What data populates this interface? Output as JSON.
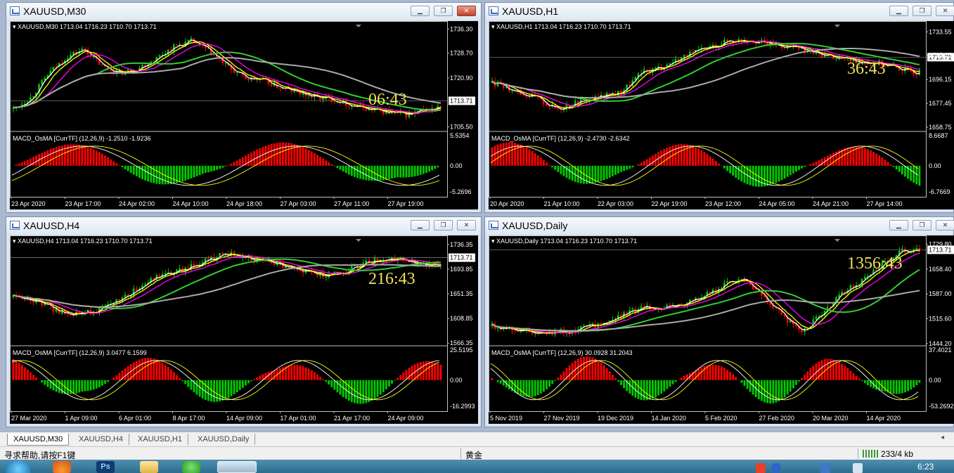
{
  "windows": [
    {
      "title": "XAUUSD,M30",
      "header": "XAUUSD,M30  1713.04 1716.23 1710.70 1713.71",
      "timer": "06:43",
      "price_ticks": [
        "1736.30",
        "1728.70",
        "1720.90",
        "1705.50"
      ],
      "price_ticks_y": [
        1736.3,
        1728.7,
        1720.9,
        1705.5
      ],
      "price_range": [
        1704.3,
        1738.8
      ],
      "current_price": "1713.71",
      "macd_label": "MACD_OsMA [CurrTF] (12,26,9) -1.2510 -1.9236",
      "macd_ticks": [
        "5.5354",
        "0.00",
        "-5.2696"
      ],
      "time_labels": [
        "23 Apr 2020",
        "23 Apr 17:00",
        "24 Apr 02:00",
        "24 Apr 10:00",
        "24 Apr 18:00",
        "27 Apr 03:00",
        "27 Apr 11:00",
        "27 Apr 19:00"
      ]
    },
    {
      "title": "XAUUSD,H1",
      "header": "XAUUSD,H1  1713.04 1716.23 1710.70 1713.71",
      "timer": "36:43",
      "price_ticks": [
        "1733.55",
        "1715.15",
        "1696.15",
        "1677.45",
        "1658.75"
      ],
      "price_ticks_y": [
        1733.55,
        1715.15,
        1696.15,
        1677.45,
        1658.75
      ],
      "price_range": [
        1656.0,
        1742.0
      ],
      "current_price": "1713.71",
      "macd_label": "MACD_OsMA [CurrTF] (12,26,9) -2.4730 -2.6342",
      "macd_ticks": [
        "8.6687",
        "0.00",
        "-6.7669"
      ],
      "time_labels": [
        "20 Apr 2020",
        "21 Apr 10:00",
        "22 Apr 03:00",
        "22 Apr 19:00",
        "23 Apr 12:00",
        "24 Apr 05:00",
        "24 Apr 21:00",
        "27 Apr 14:00"
      ]
    },
    {
      "title": "XAUUSD,H4",
      "header": "XAUUSD,H4  1713.04 1716.23 1710.70 1713.71",
      "timer": "216:43",
      "price_ticks": [
        "1736.35",
        "1693.85",
        "1651.35",
        "1608.85",
        "1566.35"
      ],
      "price_ticks_y": [
        1736.35,
        1693.85,
        1651.35,
        1608.85,
        1566.35
      ],
      "price_range": [
        1563.0,
        1752.0
      ],
      "current_price": "1713.71",
      "macd_label": "MACD_OsMA [CurrTF] (12,26,9) 3.0477 6.1599",
      "macd_ticks": [
        "25.5195",
        "0.00",
        "-16.2993"
      ],
      "time_labels": [
        "27 Mar 2020",
        "1 Apr 09:00",
        "6 Apr 01:00",
        "8 Apr 17:00",
        "14 Apr 09:00",
        "17 Apr 01:00",
        "21 Apr 17:00",
        "24 Apr 09:00"
      ]
    },
    {
      "title": "XAUUSD,Daily",
      "header": "XAUUSD,Daily  1713.04 1716.23 1710.70 1713.71",
      "timer": "1356:43",
      "price_ticks": [
        "1729.80",
        "1658.40",
        "1587.00",
        "1515.60",
        "1444.20"
      ],
      "price_ticks_y": [
        1729.8,
        1658.4,
        1587.0,
        1515.6,
        1444.2
      ],
      "price_range": [
        1440.0,
        1755.0
      ],
      "current_price": "1713.71",
      "macd_label": "MACD_OsMA [CurrTF] (12,26,9) 30.0928 31.2043",
      "macd_ticks": [
        "37.4021",
        "0.00",
        "-53.2692"
      ],
      "time_labels": [
        "5 Nov 2019",
        "27 Nov 2019",
        "19 Dec 2019",
        "14 Jan 2020",
        "5 Feb 2020",
        "27 Feb 2020",
        "20 Mar 2020",
        "14 Apr 2020"
      ]
    }
  ],
  "tabs": [
    "XAUUSD,M30",
    "XAUUSD,H4",
    "XAUUSD,H1",
    "XAUUSD,Daily"
  ],
  "status": {
    "help": "寻求帮助,请按F1键",
    "profile": "黄金",
    "traffic": "233/4 kb"
  },
  "clock": "6:23",
  "window_buttons": {
    "minimize": "▁",
    "restore": "❐",
    "close": "✕"
  },
  "colors": {
    "background": "#000000",
    "bull_candle": "#00c800",
    "bear_candle": "#ff0000",
    "ma_fast": "#ffffff",
    "ma_yellow": "#ffff00",
    "ma_magenta": "#ff00ff",
    "ma_green": "#32cd32",
    "ma_gray": "#a9a9a9",
    "timer": "#f0e05a"
  },
  "icons": [
    "window-chart-icon",
    "minimize-icon",
    "restore-icon",
    "close-icon",
    "start-orb-icon",
    "firefox-icon",
    "photoshop-icon",
    "folder-icon",
    "wechat-icon",
    "mt4-icon",
    "sogou-icon",
    "help-icon",
    "network-icon",
    "volume-icon"
  ]
}
